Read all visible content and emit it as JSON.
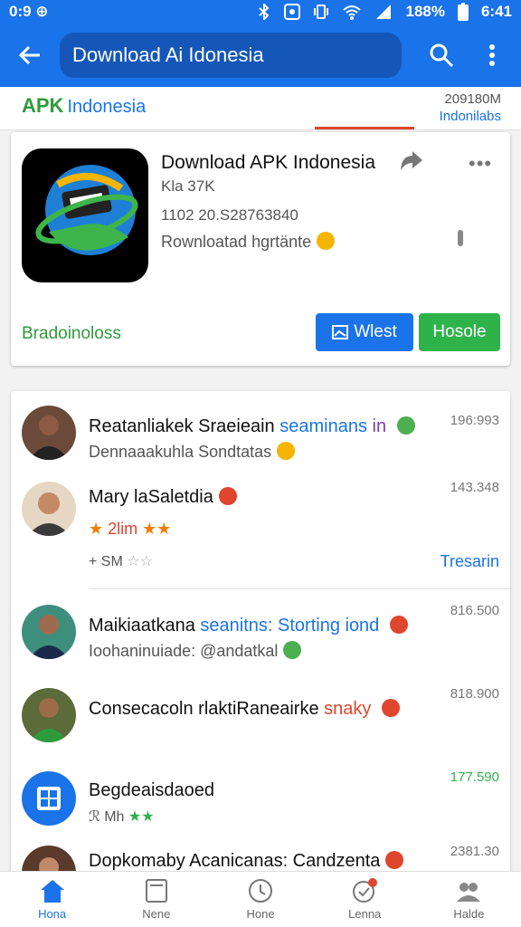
{
  "status_bar": {
    "time_left": "0:9 ⊕",
    "battery": "188%",
    "time_right": "6:41"
  },
  "app_bar": {
    "search_text": "Download Ai Idonesia"
  },
  "sub_header": {
    "brand_apk": "APK",
    "brand_rest": "Indonesia",
    "meta_line1": "209180M",
    "meta_line2": "Indonilabs"
  },
  "app_card": {
    "title": "Download APK Indonesia",
    "subtitle": "Kla 37K",
    "meta": "1102 20.S28763840",
    "description": "Rownloatad hgrtänte",
    "downloads_label": "Bradoinoloss",
    "btn_primary": "Wlest",
    "btn_secondary": "Hosole"
  },
  "list": [
    {
      "title": "Reatanliakek Sraeieain",
      "title_accent": "seaminans",
      "title_tail": "in",
      "sub": "Dennaaakuhla Sondtatas",
      "num": "196:993"
    },
    {
      "title": "Mary laSaletdia",
      "rating_text": "2lim",
      "sub2_text": "SM",
      "num": "143.348",
      "link": "Tresarin"
    },
    {
      "title": "Maikiaatkana",
      "title_accent": "seanitns: Storting iond",
      "sub": "Ioohaninuiade: @andatkal",
      "num": "816.500"
    },
    {
      "title": "Consecacoln rlaktiRaneairke",
      "title_accent": "snaky",
      "num": "818.900"
    },
    {
      "title": "Begdeaisdaoed",
      "sub2_text": "Mh",
      "num": "177.590"
    },
    {
      "title": "Dopkomaby Acanicanas: Candzenta",
      "num": "2381.30"
    }
  ],
  "bottom_nav": [
    {
      "label": "Hona",
      "icon": "home-icon"
    },
    {
      "label": "Nene",
      "icon": "news-icon"
    },
    {
      "label": "Hone",
      "icon": "clock-icon"
    },
    {
      "label": "Lenna",
      "icon": "updates-icon"
    },
    {
      "label": "Halde",
      "icon": "profile-icon"
    }
  ],
  "colors": {
    "primary": "#1a73e8",
    "green": "#2db34a",
    "accent_red": "#e0452d"
  }
}
